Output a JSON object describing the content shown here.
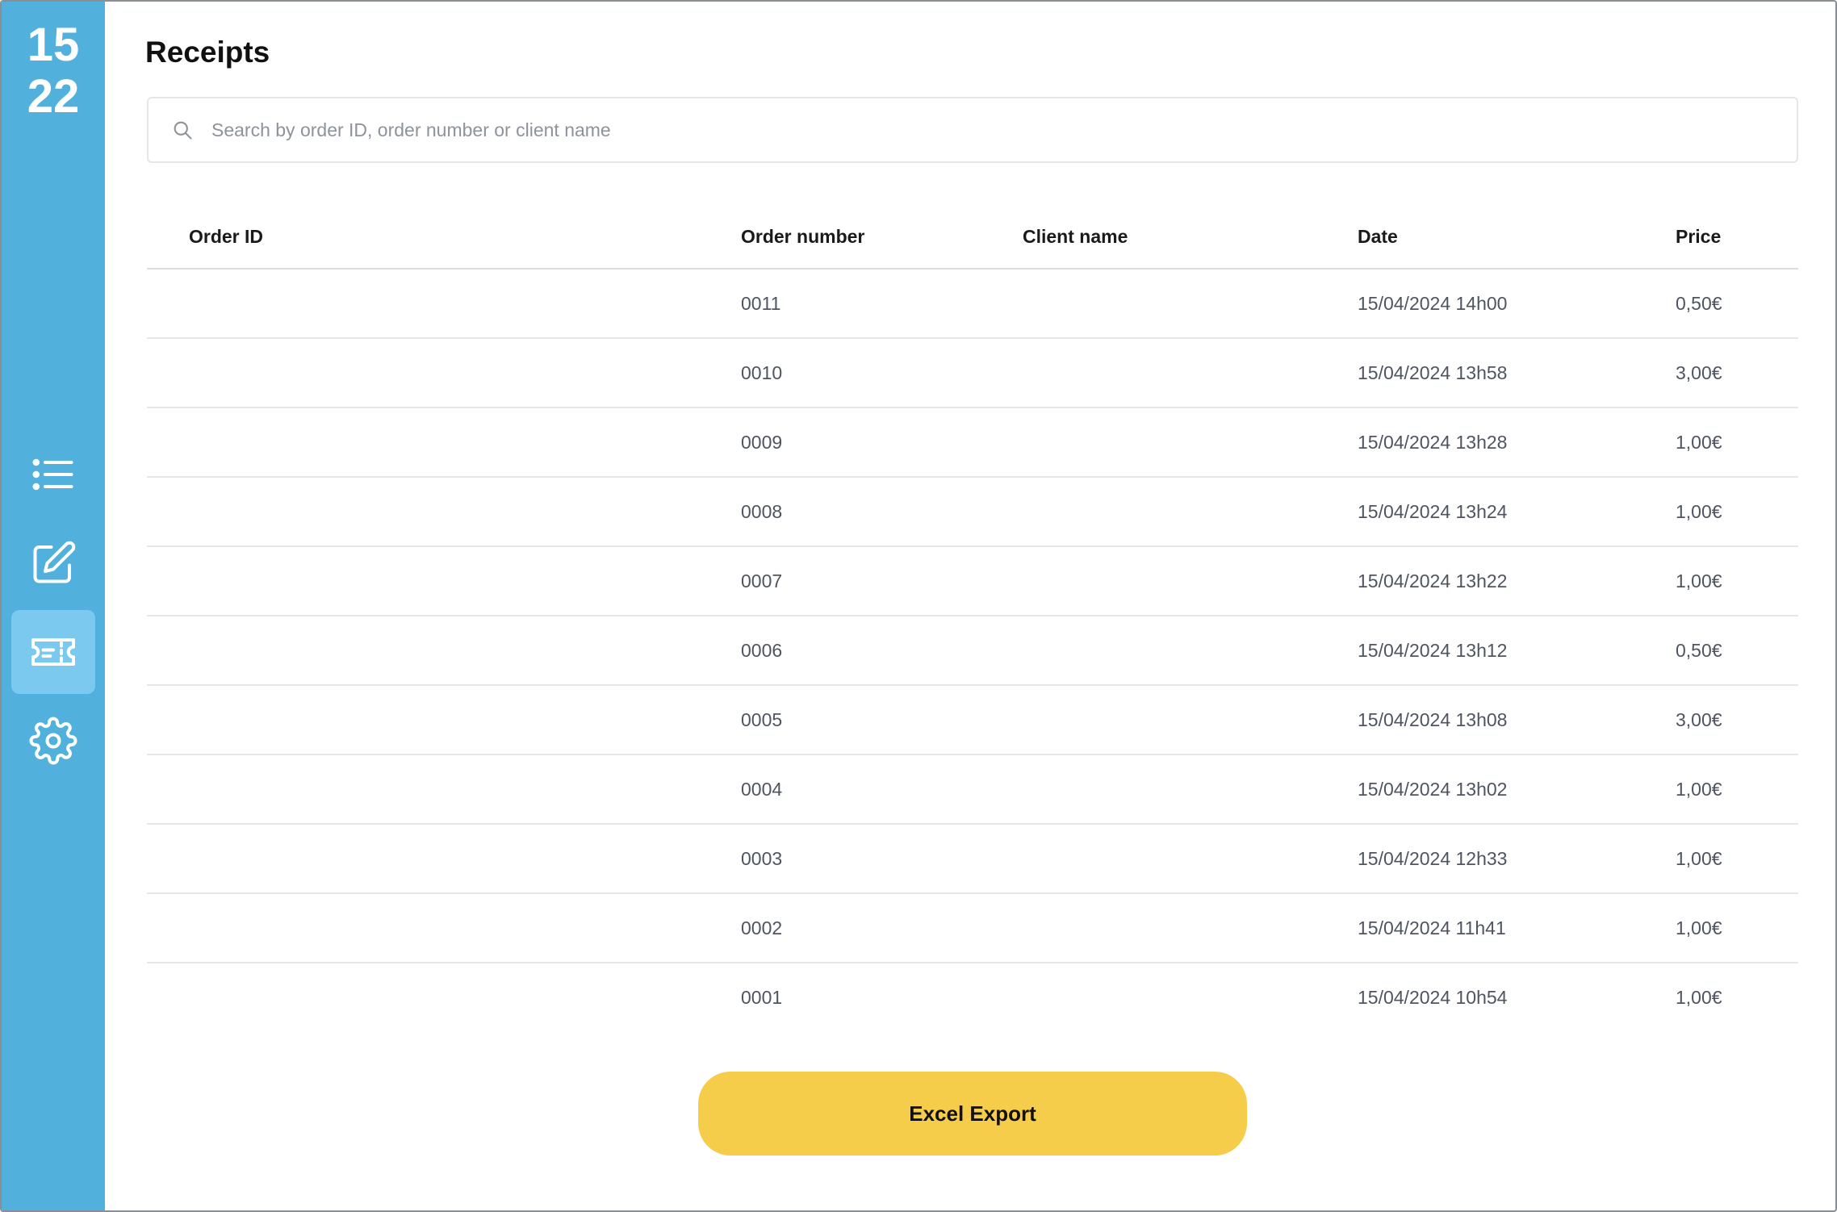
{
  "clock": {
    "hours": "15",
    "minutes": "22"
  },
  "colors": {
    "sidebar": "#52b1dc",
    "active_nav": "#7cc9f0",
    "export_button": "#f6cd4a"
  },
  "sidebar": {
    "items": [
      {
        "icon": "list-icon",
        "active": false
      },
      {
        "icon": "edit-icon",
        "active": false
      },
      {
        "icon": "ticket-icon",
        "active": true
      },
      {
        "icon": "gear-icon",
        "active": false
      }
    ]
  },
  "page": {
    "title": "Receipts"
  },
  "search": {
    "icon": "search-icon",
    "placeholder": "Search by order ID, order number or client name",
    "value": ""
  },
  "table": {
    "columns": [
      "Order ID",
      "Order number",
      "Client name",
      "Date",
      "Price"
    ],
    "rows": [
      {
        "order_id": "",
        "order_number": "0011",
        "client_name": "",
        "date": "15/04/2024 14h00",
        "price": "0,50€"
      },
      {
        "order_id": "",
        "order_number": "0010",
        "client_name": "",
        "date": "15/04/2024 13h58",
        "price": "3,00€"
      },
      {
        "order_id": "",
        "order_number": "0009",
        "client_name": "",
        "date": "15/04/2024 13h28",
        "price": "1,00€"
      },
      {
        "order_id": "",
        "order_number": "0008",
        "client_name": "",
        "date": "15/04/2024 13h24",
        "price": "1,00€"
      },
      {
        "order_id": "",
        "order_number": "0007",
        "client_name": "",
        "date": "15/04/2024 13h22",
        "price": "1,00€"
      },
      {
        "order_id": "",
        "order_number": "0006",
        "client_name": "",
        "date": "15/04/2024 13h12",
        "price": "0,50€"
      },
      {
        "order_id": "",
        "order_number": "0005",
        "client_name": "",
        "date": "15/04/2024 13h08",
        "price": "3,00€"
      },
      {
        "order_id": "",
        "order_number": "0004",
        "client_name": "",
        "date": "15/04/2024 13h02",
        "price": "1,00€"
      },
      {
        "order_id": "",
        "order_number": "0003",
        "client_name": "",
        "date": "15/04/2024 12h33",
        "price": "1,00€"
      },
      {
        "order_id": "",
        "order_number": "0002",
        "client_name": "",
        "date": "15/04/2024 11h41",
        "price": "1,00€"
      },
      {
        "order_id": "",
        "order_number": "0001",
        "client_name": "",
        "date": "15/04/2024 10h54",
        "price": "1,00€"
      }
    ]
  },
  "export": {
    "label": "Excel Export"
  }
}
